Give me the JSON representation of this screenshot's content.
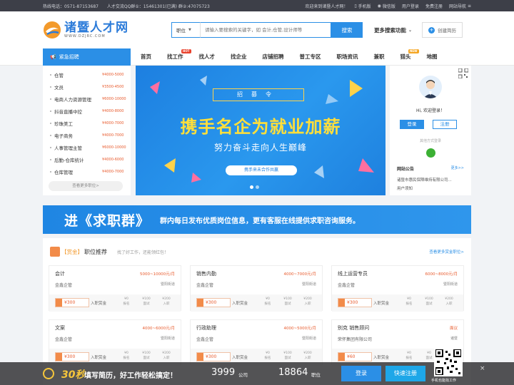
{
  "topbar": {
    "hotline": "热线电话：0571-87153687",
    "qq": "人才交流QQ群①：15461301(已满) 群②:47075723",
    "welcome": "欢迎来到诸暨人才网！",
    "mobile": "手机版",
    "wechat": "微信版",
    "user_login": "用户登录",
    "free_register": "免费注册",
    "site_nav": "网站导航"
  },
  "header": {
    "logo_cn": "诸暨人才网",
    "logo_en": "WWW.DZJRC.COM",
    "search_type": "职位",
    "search_placeholder": "请输入要搜索的关键字，如 会计,仓管,设计师等",
    "search_button": "搜索",
    "more_search": "更多搜索功能",
    "create_resume": "创建简历"
  },
  "nav": {
    "urgent": "紧急招聘",
    "items": [
      {
        "label": "首页"
      },
      {
        "label": "找工作",
        "badge": "HOT"
      },
      {
        "label": "找人才"
      },
      {
        "label": "找企业"
      },
      {
        "label": "店铺招聘"
      },
      {
        "label": "普工专区"
      },
      {
        "label": "职场资讯"
      },
      {
        "label": "兼职"
      },
      {
        "label": "猎头",
        "badge": "NEW"
      },
      {
        "label": "地图"
      }
    ]
  },
  "urgent_jobs": [
    {
      "name": "仓管",
      "salary": "¥4000-5000"
    },
    {
      "name": "文员",
      "salary": "¥3500-4500"
    },
    {
      "name": "电商人力资源管理",
      "salary": "¥6000-10000"
    },
    {
      "name": "抖音直播中控",
      "salary": "¥4000-8000"
    },
    {
      "name": "珍珠美工",
      "salary": "¥4000-7000"
    },
    {
      "name": "电子商务",
      "salary": "¥4000-7000"
    },
    {
      "name": "人事管理主管",
      "salary": "¥6000-10000"
    },
    {
      "name": "后勤-仓库统计",
      "salary": "¥4000-6000"
    },
    {
      "name": "仓库管理",
      "salary": "¥4000-7000"
    }
  ],
  "urgent_more": "查看更多职位>",
  "banner": {
    "zhao": "招募令",
    "headline": "携手名企为就业加薪",
    "sub": "努力奋斗走向人生巅峰",
    "pill": "携手来未合作共赢"
  },
  "user": {
    "hello": "Hi, 欢迎登录！",
    "login": "登录",
    "register": "注册",
    "other_login": "其他方式登录",
    "notice_title": "网站公告",
    "notice_more": "更多>>",
    "notices": [
      "诸暨市惠民保障维持有限公司...",
      "用户须知"
    ]
  },
  "wide_banner": {
    "big": "进《求职群》",
    "small": "群内每日发布优质岗位信息，更有客服在线提供求职咨询服务。"
  },
  "jobs": {
    "bonus": "【赏金】",
    "title": "职位推荐",
    "sub": "找了好工作，还能领红包！",
    "more": "查看更多赏金职位>",
    "reward_label": "入职赏金",
    "stat_labels": [
      "报名",
      "面试",
      "入职"
    ],
    "cards": [
      {
        "title": "会计",
        "salary": "5000~10000元/月",
        "company": "金鑫企管",
        "location": "暨阳街道",
        "reward": "¥300",
        "stats": [
          "¥0",
          "¥100",
          "¥200"
        ]
      },
      {
        "title": "销售内勤",
        "salary": "4000~7000元/月",
        "company": "金鑫企管",
        "location": "暨阳街道",
        "reward": "¥300",
        "stats": [
          "¥0",
          "¥100",
          "¥200"
        ]
      },
      {
        "title": "线上运营专员",
        "salary": "6000~8000元/月",
        "company": "金鑫企管",
        "location": "暨阳街道",
        "reward": "¥300",
        "stats": [
          "¥0",
          "¥100",
          "¥200"
        ]
      },
      {
        "title": "文案",
        "salary": "4000~6000元/月",
        "company": "金鑫企管",
        "location": "暨阳街道",
        "reward": "¥300",
        "stats": [
          "¥0",
          "¥100",
          "¥200"
        ]
      },
      {
        "title": "行政助理",
        "salary": "4000~5000元/月",
        "company": "金鑫企管",
        "location": "暨阳街道",
        "reward": "¥300",
        "stats": [
          "¥0",
          "¥100",
          "¥200"
        ]
      },
      {
        "title": "别克 销售顾问",
        "salary": "面议",
        "company": "荣怀集团有限公司",
        "location": "诸暨",
        "reward": "¥60",
        "stats": [
          "¥0",
          "¥0",
          "¥60"
        ]
      }
    ]
  },
  "float_bar": {
    "seconds": "30秒",
    "message": "填写简历，好工作轻松搞定！",
    "company_count": "3999",
    "company_unit": "公司",
    "job_count": "18864",
    "job_unit": "职位",
    "login": "登录",
    "quick_register": "快速注册",
    "qr_text": "手机也能找工作",
    "close": "×"
  },
  "colors": {
    "accent": "#2b8fe6",
    "salary": "#e85a2c",
    "login_btn": "#2b8fe6",
    "register_btn": "#1ea7e8",
    "headline": "#ffdf3a"
  }
}
